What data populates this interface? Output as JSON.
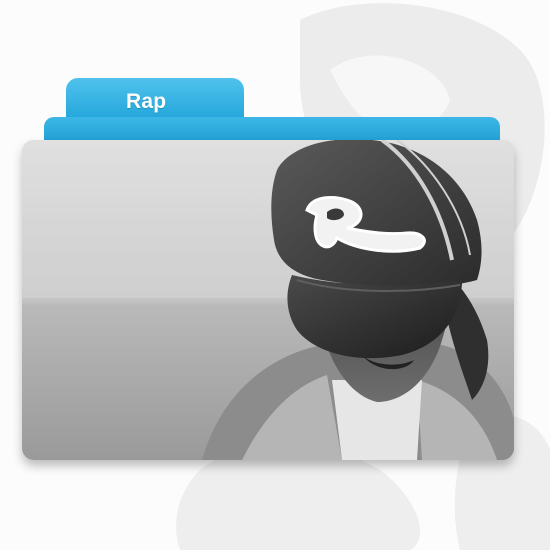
{
  "folder": {
    "label": "Rap",
    "tab_color": "#1fa3d9",
    "cap_logo_glyph": "R"
  },
  "icons": {
    "folder": "folder-icon",
    "artwork": "rapper-portrait-icon"
  }
}
